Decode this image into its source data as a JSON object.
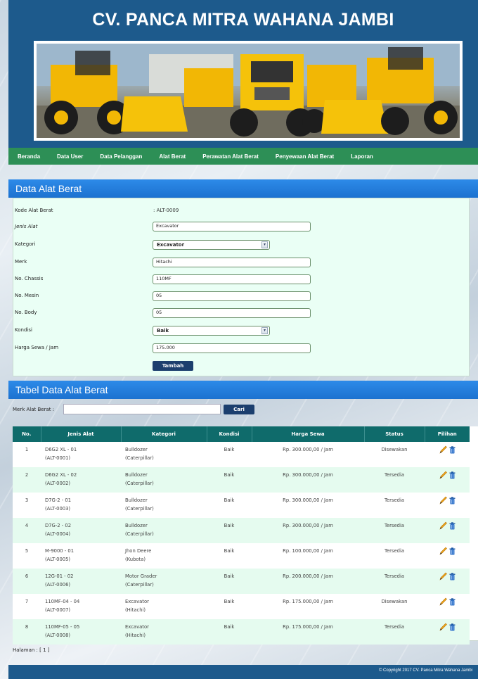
{
  "site": {
    "title": "CV. PANCA MITRA WAHANA JAMBI"
  },
  "nav": [
    "Beranda",
    "Data User",
    "Data Pelanggan",
    "Alat Berat",
    "Perawatan Alat Berat",
    "Penyewaan Alat Berat",
    "Laporan"
  ],
  "form": {
    "section_title": "Data Alat Berat",
    "kode_label": "Kode Alat Berat",
    "kode_value": ": ALT-0009",
    "jenis_label": "Jenis Alat",
    "jenis_value": "Excavator",
    "kategori_label": "Kategori",
    "kategori_value": "Excavator",
    "merk_label": "Merk",
    "merk_value": "Hitachi",
    "chassis_label": "No. Chassis",
    "chassis_value": "110MF",
    "mesin_label": "No. Mesin",
    "mesin_value": "05",
    "body_label": "No. Body",
    "body_value": "05",
    "kondisi_label": "Kondisi",
    "kondisi_value": "Baik",
    "harga_label": "Harga Sewa / Jam",
    "harga_value": "175.000",
    "submit_label": "Tambah"
  },
  "table_section": {
    "title": "Tabel Data Alat Berat",
    "search_label": "Merk Alat Berat :",
    "search_value": "",
    "search_button": "Cari"
  },
  "table": {
    "headers": [
      "No.",
      "Jenis Alat",
      "Kategori",
      "Kondisi",
      "Harga Sewa",
      "Status",
      "Pilihan"
    ],
    "rows": [
      {
        "no": "1",
        "jenis": "D6G2 XL - 01",
        "kode": "(ALT-0001)",
        "kategori": "Bulldozer",
        "merk": "(Caterpillar)",
        "kondisi": "Baik",
        "harga": "Rp. 300.000,00 / Jam",
        "status": "Disewakan"
      },
      {
        "no": "2",
        "jenis": "D6G2 XL - 02",
        "kode": "(ALT-0002)",
        "kategori": "Bulldozer",
        "merk": "(Caterpillar)",
        "kondisi": "Baik",
        "harga": "Rp. 300.000,00 / Jam",
        "status": "Tersedia"
      },
      {
        "no": "3",
        "jenis": "D7G-2 - 01",
        "kode": "(ALT-0003)",
        "kategori": "Bulldozer",
        "merk": "(Caterpillar)",
        "kondisi": "Baik",
        "harga": "Rp. 300.000,00 / Jam",
        "status": "Tersedia"
      },
      {
        "no": "4",
        "jenis": "D7G-2 - 02",
        "kode": "(ALT-0004)",
        "kategori": "Bulldozer",
        "merk": "(Caterpillar)",
        "kondisi": "Baik",
        "harga": "Rp. 300.000,00 / Jam",
        "status": "Tersedia"
      },
      {
        "no": "5",
        "jenis": "M-9000 - 01",
        "kode": "(ALT-0005)",
        "kategori": "Jhon Deere",
        "merk": "(Kubota)",
        "kondisi": "Baik",
        "harga": "Rp. 100.000,00 / Jam",
        "status": "Tersedia"
      },
      {
        "no": "6",
        "jenis": "12G-01 - 02",
        "kode": "(ALT-0006)",
        "kategori": "Motor Grader",
        "merk": "(Caterpillar)",
        "kondisi": "Baik",
        "harga": "Rp. 200.000,00 / Jam",
        "status": "Tersedia"
      },
      {
        "no": "7",
        "jenis": "110MF-04 - 04",
        "kode": "(ALT-0007)",
        "kategori": "Excavator",
        "merk": "(Hitachi)",
        "kondisi": "Baik",
        "harga": "Rp. 175.000,00 / Jam",
        "status": "Disewakan"
      },
      {
        "no": "8",
        "jenis": "110MF-05 - 05",
        "kode": "(ALT-0008)",
        "kategori": "Excavator",
        "merk": "(Hitachi)",
        "kondisi": "Baik",
        "harga": "Rp. 175.000,00 / Jam",
        "status": "Tersedia"
      }
    ]
  },
  "pagination": {
    "text": "Halaman : [ 1 ]"
  },
  "footer": {
    "text": "© Copyright 2017 CV. Panca Mitra Wahana Jambi"
  },
  "colors": {
    "header": "#1d5a8c",
    "nav": "#2d8f56",
    "section": "#1c72d0",
    "table_header": "#0f6b6b",
    "form_bg": "#eafff5"
  }
}
